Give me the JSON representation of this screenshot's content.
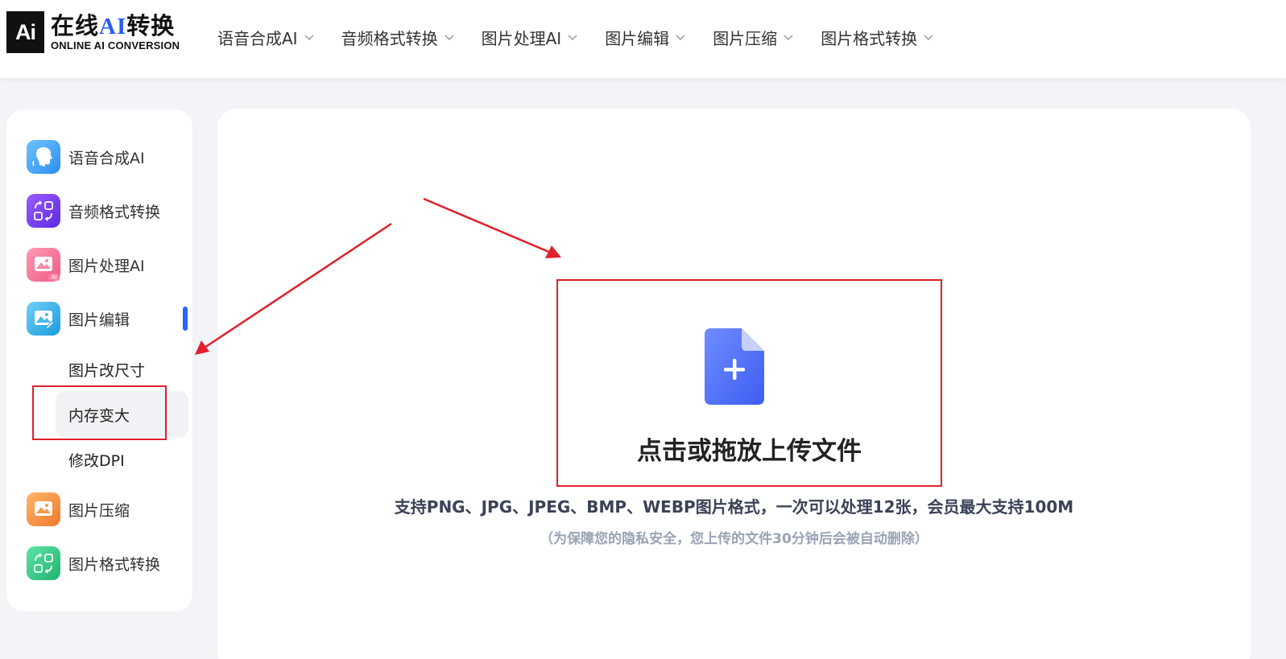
{
  "header": {
    "logo": {
      "mark": "Ai",
      "title_prefix": "在线",
      "title_ai": "AI",
      "title_suffix": "转换",
      "subtitle": "ONLINE AI CONVERSION"
    },
    "nav": [
      {
        "label": "语音合成AI"
      },
      {
        "label": "音频格式转换"
      },
      {
        "label": "图片处理AI"
      },
      {
        "label": "图片编辑"
      },
      {
        "label": "图片压缩"
      },
      {
        "label": "图片格式转换"
      }
    ]
  },
  "sidebar": {
    "items": [
      {
        "label": "语音合成AI",
        "icon": "voice-icon",
        "color": "#3aa7f5"
      },
      {
        "label": "音频格式转换",
        "icon": "audio-convert-icon",
        "color": "#7a3cf0"
      },
      {
        "label": "图片处理AI",
        "icon": "image-ai-icon",
        "color": "#f2678f",
        "badge": "AI"
      },
      {
        "label": "图片编辑",
        "icon": "image-edit-icon",
        "color": "#29a9e6"
      },
      {
        "label": "图片压缩",
        "icon": "image-compress-icon",
        "color": "#f5883a"
      },
      {
        "label": "图片格式转换",
        "icon": "image-format-icon",
        "color": "#25c07c"
      }
    ],
    "sub_items": [
      {
        "label": "图片改尺寸"
      },
      {
        "label": "内存变大",
        "active": true
      },
      {
        "label": "修改DPI"
      }
    ]
  },
  "upload": {
    "title": "点击或拖放上传文件",
    "description": "支持PNG、JPG、JPEG、BMP、WEBP图片格式，一次可以处理12张，会员最大支持100M",
    "note": "（为保障您的隐私安全，您上传的文件30分钟后会被自动删除）",
    "icon": "file-plus-icon",
    "icon_color": "#4a6cf7"
  },
  "annotations": {
    "color": "#e0202a"
  }
}
